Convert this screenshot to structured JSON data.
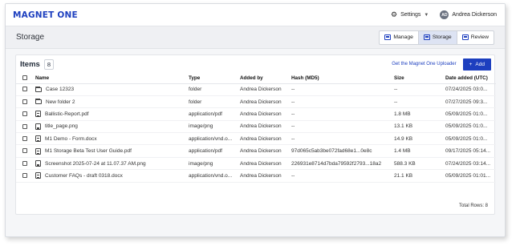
{
  "app": {
    "logo_main": "MAGNET",
    "logo_suffix": "ONE",
    "settings_label": "Settings",
    "user_name": "Andrea Dickerson",
    "user_initials": "AD"
  },
  "page": {
    "title": "Storage",
    "tabs": [
      {
        "label": "Manage",
        "active": false
      },
      {
        "label": "Storage",
        "active": true
      },
      {
        "label": "Review",
        "active": false
      }
    ]
  },
  "items": {
    "title": "Items",
    "count": "8",
    "uploader_link": "Get the Magnet One Uploader",
    "add_label": "Add",
    "add_icon": "+",
    "columns": [
      "Name",
      "Type",
      "Added by",
      "Hash (MD5)",
      "Size",
      "Date added (UTC)"
    ],
    "rows": [
      {
        "icon": "folder",
        "name": "Case 12323",
        "type": "folder",
        "added_by": "Andrea Dickerson",
        "hash": "--",
        "size": "--",
        "date": "07/24/2025 03:0..."
      },
      {
        "icon": "folder",
        "name": "New folder 2",
        "type": "folder",
        "added_by": "Andrea Dickerson",
        "hash": "--",
        "size": "--",
        "date": "07/27/2025 09:3..."
      },
      {
        "icon": "doc",
        "name": "Ballistic-Report.pdf",
        "type": "application/pdf",
        "added_by": "Andrea Dickerson",
        "hash": "--",
        "size": "1.8 MB",
        "date": "05/09/2025 01:0..."
      },
      {
        "icon": "img",
        "name": "title_page.png",
        "type": "image/png",
        "added_by": "Andrea Dickerson",
        "hash": "--",
        "size": "13.1 KB",
        "date": "05/09/2025 01:0..."
      },
      {
        "icon": "doc",
        "name": "M1 Demo - Form.docx",
        "type": "application/vnd.o...",
        "added_by": "Andrea Dickerson",
        "hash": "--",
        "size": "14.9 KB",
        "date": "05/09/2025 01:0..."
      },
      {
        "icon": "doc",
        "name": "M1 Storage Beta Test User Guide.pdf",
        "type": "application/pdf",
        "added_by": "Andrea Dickerson",
        "hash": "97d065c5ab3be072fad68e1...0e8c",
        "size": "1.4 MB",
        "date": "09/17/2025 05:14..."
      },
      {
        "icon": "img",
        "name": "Screenshot 2025-07-24 at 11.07.37 AM.png",
        "type": "image/png",
        "added_by": "Andrea Dickerson",
        "hash": "226931e8714d7bda79592f2793...18a2",
        "size": "588.3 KB",
        "date": "07/24/2025 03:14..."
      },
      {
        "icon": "doc",
        "name": "Customer FAQs - draft 0318.docx",
        "type": "application/vnd.o...",
        "added_by": "Andrea Dickerson",
        "hash": "--",
        "size": "21.1 KB",
        "date": "05/09/2025 01:01..."
      }
    ],
    "total_rows_label": "Total Rows: 8"
  },
  "colors": {
    "brand": "#1d3fbf",
    "active_tab": "#dde3f3"
  },
  "icons": {
    "settings": "gear-icon",
    "caret": "chevron-down-icon",
    "tab": "panel-icon",
    "folder": "folder-icon",
    "doc": "document-icon",
    "img": "image-icon"
  }
}
